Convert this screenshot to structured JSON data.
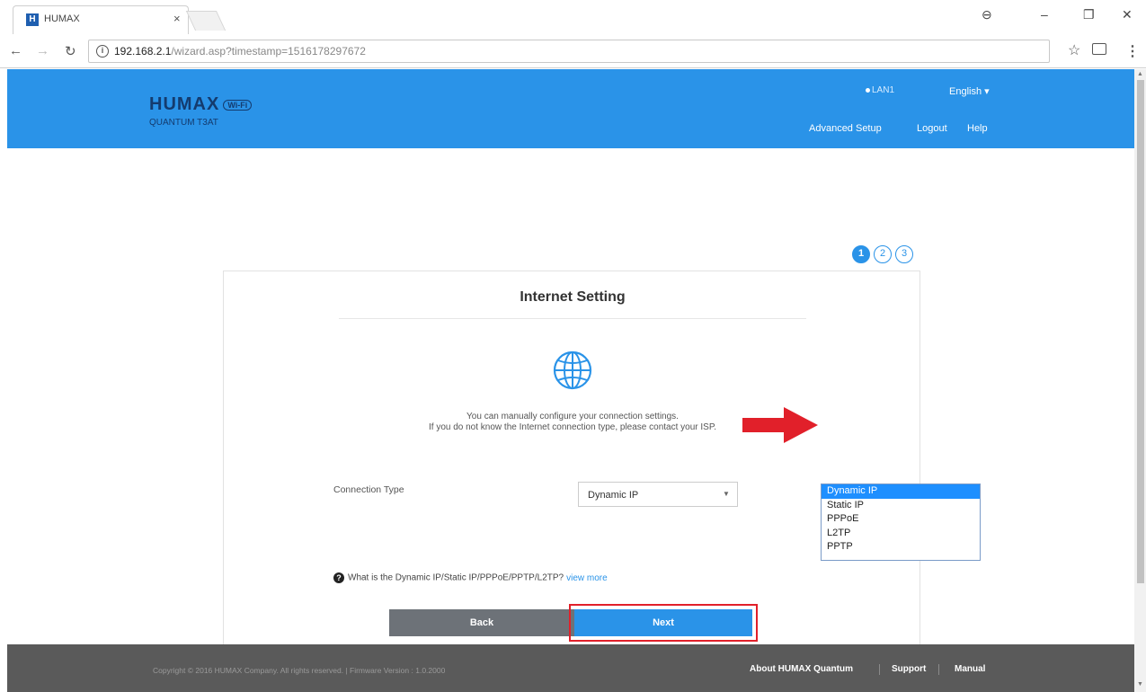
{
  "browser": {
    "tab_title": "HUMAX",
    "tab_favicon": "H",
    "url_host": "192.168.2.1",
    "url_path": "/wizard.asp?timestamp=1516178297672"
  },
  "header": {
    "logo": "HUMAX",
    "logo_badge": "Wi-Fi",
    "model": "QUANTUM T3AT",
    "lan_status": "LAN1",
    "language": "English ▾",
    "nav": {
      "advanced": "Advanced Setup",
      "logout": "Logout",
      "help": "Help"
    }
  },
  "steps": [
    "1",
    "2",
    "3"
  ],
  "card": {
    "title": "Internet Setting",
    "desc_line1": "You can manually configure your connection settings.",
    "desc_line2": "If you do not know the Internet connection type, please contact your ISP.",
    "connection_label": "Connection Type",
    "connection_value": "Dynamic IP",
    "help_text": "What is the Dynamic IP/Static IP/PPPoE/PPTP/L2TP?",
    "view_more": "view more",
    "back": "Back",
    "next": "Next"
  },
  "dropdown": {
    "options": [
      "Dynamic IP",
      "Static IP",
      "PPPoE",
      "L2TP",
      "PPTP"
    ],
    "selected": "Dynamic IP"
  },
  "footer": {
    "copyright": "Copyright © 2016 HUMAX Company. All rights reserved. | Firmware Version : 1.0.2000",
    "about": "About HUMAX Quantum",
    "support": "Support",
    "manual": "Manual"
  },
  "colors": {
    "brand_blue": "#2a93e8",
    "arrow_red": "#e1202a",
    "footer_gray": "#5a5a5a"
  }
}
